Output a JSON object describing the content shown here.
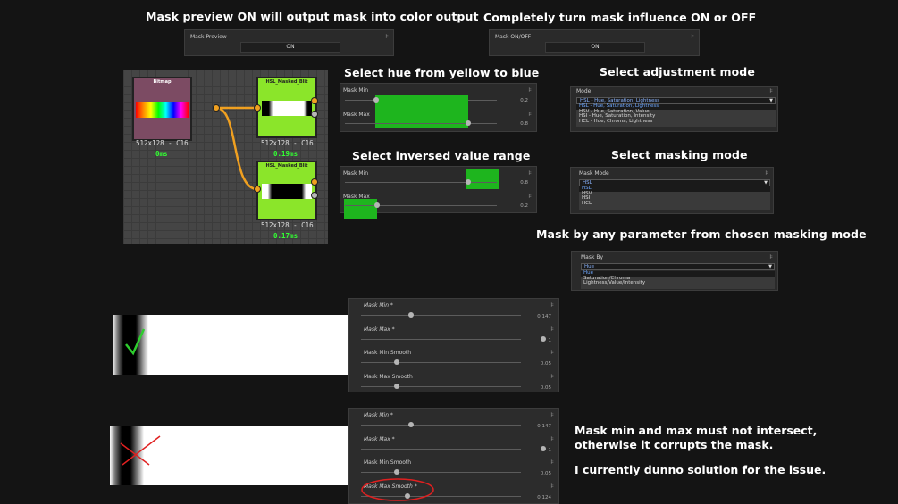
{
  "headings": {
    "mask_preview": "Mask preview ON will output mask into color output",
    "mask_on_off": "Completely turn mask influence ON or OFF",
    "select_hue": "Select hue from  yellow to blue",
    "select_adjustment": "Select adjustment mode",
    "select_inversed": "Select inversed value range",
    "select_masking": "Select masking mode",
    "mask_by_param": "Mask by any parameter from chosen masking mode"
  },
  "mask_preview_panel": {
    "title": "Mask Preview",
    "value": "ON"
  },
  "mask_onoff_panel": {
    "title": "Mask ON/OFF",
    "value": "ON"
  },
  "graph": {
    "bitmap_node": {
      "title": "Bitmap",
      "size": "512x128 - C16",
      "time": "0ms"
    },
    "hsl_node_1": {
      "title": "HSL_Masked_Blit",
      "size": "512x128 - C16",
      "time": "0.19ms"
    },
    "hsl_node_2": {
      "title": "HSL_Masked_Blit",
      "size": "512x128 - C16",
      "time": "0.17ms"
    }
  },
  "hue_panel": {
    "min_label": "Mask Min",
    "min_value": "0.2",
    "max_label": "Mask Max",
    "max_value": "0.8"
  },
  "inversed_panel": {
    "min_label": "Mask Min",
    "min_value": "0.8",
    "max_label": "Mask Max",
    "max_value": "0.2"
  },
  "mode_panel": {
    "title": "Mode",
    "selected": "HSL - Hue, Saturation, Lightness",
    "options": [
      "HSL - Hue, Saturation, Lightness",
      "HSV - Hue, Saturation, Value",
      "HSI - Hue,  Saturation, Intensity",
      "HCL - Hue, Chroma, Lightness"
    ]
  },
  "mask_mode_panel": {
    "title": "Mask Mode",
    "selected": "HSL",
    "options": [
      "HSL",
      "HSV",
      "HSI",
      "HCL"
    ]
  },
  "mask_by_panel": {
    "title": "Mask By",
    "selected": "Hue",
    "options": [
      "Hue",
      "Saturation/Chroma",
      "Lightness/Value/Intensity"
    ]
  },
  "good_panel": {
    "rows": [
      {
        "label": "Mask Min *",
        "value": "0.147",
        "level": 0.147
      },
      {
        "label": "Mask Max *",
        "value": "1",
        "level": 1
      },
      {
        "label": "Mask Min Smooth",
        "value": "0.05",
        "level": 0.05
      },
      {
        "label": "Mask Max Smooth",
        "value": "0.05",
        "level": 0.05
      }
    ]
  },
  "bad_panel": {
    "rows": [
      {
        "label": "Mask Min *",
        "value": "0.147",
        "level": 0.147
      },
      {
        "label": "Mask Max *",
        "value": "1",
        "level": 1
      },
      {
        "label": "Mask Min Smooth",
        "value": "0.05",
        "level": 0.05
      },
      {
        "label": "Mask Max Smooth *",
        "value": "0.124",
        "level": 0.124
      }
    ]
  },
  "notes": {
    "line1": "Mask min and max must not  intersect,",
    "line2": "otherwise it corrupts the mask.",
    "line3": "I currently dunno solution for the issue."
  },
  "colors": {
    "node_green": "#8be52a",
    "wire": "#f0a020",
    "check": "#2ecc2e",
    "cross": "#e02020",
    "slider_fill": "#1eb51e"
  }
}
